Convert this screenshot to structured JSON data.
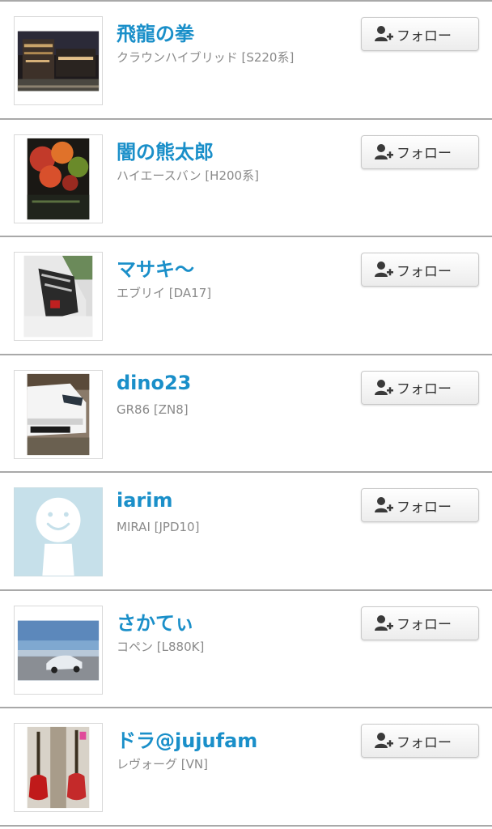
{
  "follow_label": "フォロー",
  "colors": {
    "name": "#1a8fc9",
    "car": "#8a8a8a",
    "divider": "#a9a9a9"
  },
  "users": [
    {
      "name": "飛龍の拳",
      "car": "クラウンハイブリッド [S220系]",
      "avatar": "night-street-photo"
    },
    {
      "name": "闇の熊太郎",
      "car": "ハイエースバン [H200系]",
      "avatar": "autumn-leaves-photo"
    },
    {
      "name": "マサキ〜",
      "car": "エブリイ [DA17]",
      "avatar": "car-interior-rollcage-photo"
    },
    {
      "name": "dino23",
      "car": "GR86 [ZN8]",
      "avatar": "white-car-front-photo"
    },
    {
      "name": "iarim",
      "car": "MIRAI [JPD10]",
      "avatar": "default-smiley-avatar"
    },
    {
      "name": "さかてぃ",
      "car": "コペン [L880K]",
      "avatar": "car-by-sea-photo"
    },
    {
      "name": "ドラ@jujufam",
      "car": "レヴォーグ [VN]",
      "avatar": "guitars-photo"
    }
  ]
}
